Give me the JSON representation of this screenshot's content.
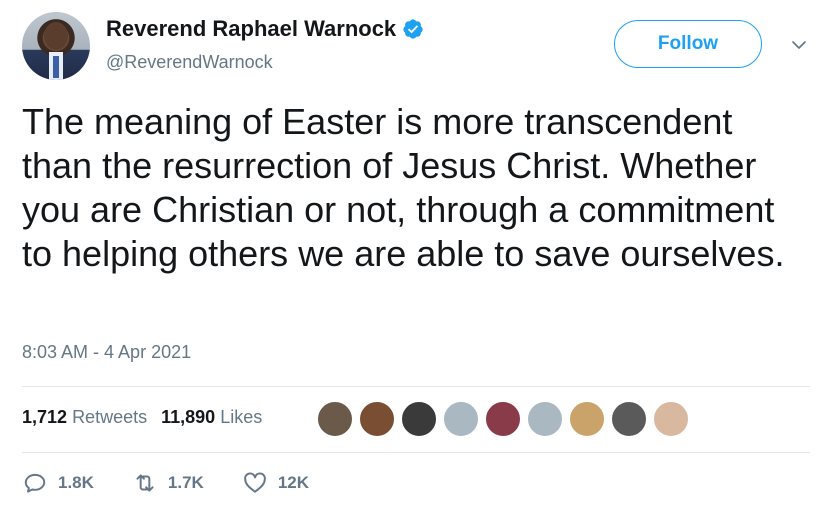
{
  "user": {
    "name": "Reverend Raphael Warnock",
    "handle": "@ReverendWarnock",
    "verified_icon": "verified-badge-icon"
  },
  "follow_label": "Follow",
  "tweet": {
    "text": "The meaning of Easter is more transcendent than the resurrection of Jesus Christ. Whether you are Christian or not, through a commitment to helping others we are able to save ourselves.",
    "timestamp": "8:03 AM - 4 Apr 2021"
  },
  "stats": {
    "retweets_count": "1,712",
    "retweets_label": "Retweets",
    "likes_count": "11,890",
    "likes_label": "Likes"
  },
  "likers": [
    {
      "icon": "liker-avatar-1",
      "color": "#6b5a4a"
    },
    {
      "icon": "liker-avatar-2",
      "color": "#7a4e33"
    },
    {
      "icon": "liker-avatar-3",
      "color": "#3a3a3a"
    },
    {
      "icon": "liker-avatar-default-4",
      "color": "#aab8c2"
    },
    {
      "icon": "liker-avatar-5",
      "color": "#8a3b4a"
    },
    {
      "icon": "liker-avatar-default-6",
      "color": "#aab8c2"
    },
    {
      "icon": "liker-avatar-7",
      "color": "#c9a36a"
    },
    {
      "icon": "liker-avatar-8",
      "color": "#5a5a5a"
    },
    {
      "icon": "liker-avatar-9",
      "color": "#d9b8a0"
    }
  ],
  "actions": {
    "replies": "1.8K",
    "retweets": "1.7K",
    "likes": "12K"
  },
  "colors": {
    "accent": "#1da1f2",
    "text": "#14171a",
    "secondary_text": "#657786",
    "divider": "#e1e8ed"
  }
}
